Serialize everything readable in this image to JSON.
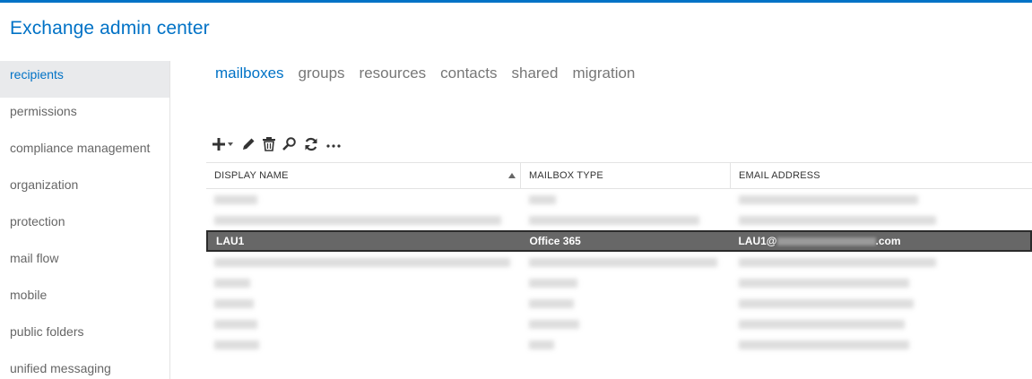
{
  "app": {
    "title": "Exchange admin center"
  },
  "sidebar": {
    "items": [
      {
        "label": "recipients",
        "active": true
      },
      {
        "label": "permissions"
      },
      {
        "label": "compliance management"
      },
      {
        "label": "organization"
      },
      {
        "label": "protection"
      },
      {
        "label": "mail flow"
      },
      {
        "label": "mobile"
      },
      {
        "label": "public folders"
      },
      {
        "label": "unified messaging"
      }
    ]
  },
  "tabs": [
    {
      "label": "mailboxes",
      "active": true
    },
    {
      "label": "groups"
    },
    {
      "label": "resources"
    },
    {
      "label": "contacts"
    },
    {
      "label": "shared"
    },
    {
      "label": "migration"
    }
  ],
  "toolbar": {
    "buttons": [
      "add-icon",
      "edit-icon",
      "delete-icon",
      "search-icon",
      "refresh-icon",
      "more-icon"
    ]
  },
  "grid": {
    "columns": [
      "DISPLAY NAME",
      "MAILBOX TYPE",
      "EMAIL ADDRESS"
    ],
    "sort": {
      "column": "DISPLAY NAME",
      "direction": "ascending"
    },
    "rows": [
      {
        "name": "",
        "type": "",
        "email": "",
        "blurred": true
      },
      {
        "name": "",
        "type": "",
        "email": "",
        "blurred": true
      },
      {
        "name": "LAU1",
        "type": "Office 365",
        "email": "LAU1@",
        "email_suffix": ".com",
        "selected": true
      },
      {
        "name": "",
        "type": "",
        "email": "",
        "blurred": true
      },
      {
        "name": "",
        "type": "",
        "email": "",
        "blurred": true
      },
      {
        "name": "",
        "type": "",
        "email": "",
        "blurred": true
      },
      {
        "name": "",
        "type": "",
        "email": "",
        "blurred": true
      },
      {
        "name": "",
        "type": "",
        "email": "",
        "blurred": true
      }
    ]
  },
  "colors": {
    "accent": "#0072c6",
    "selected_row": "#676767"
  }
}
